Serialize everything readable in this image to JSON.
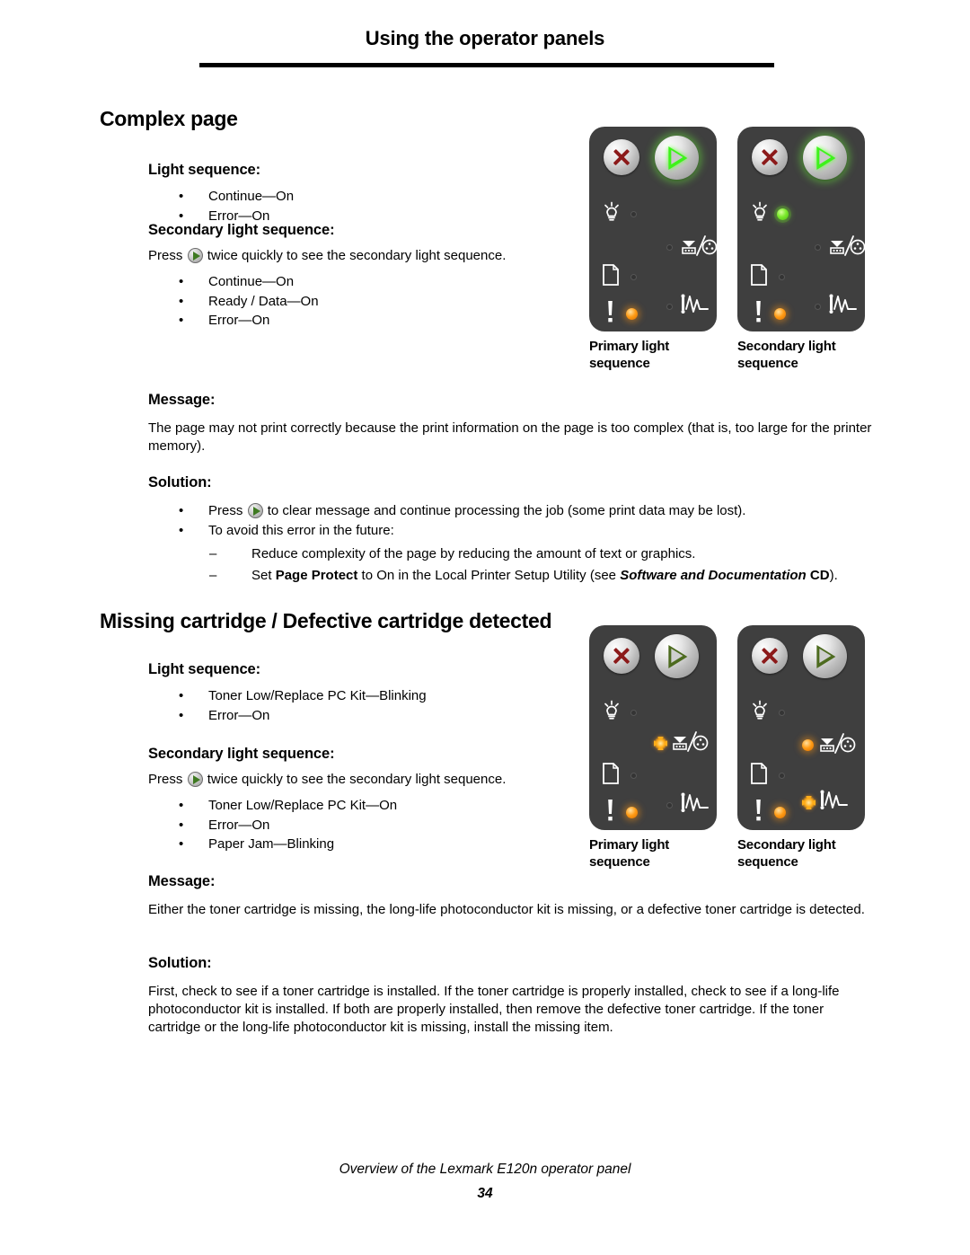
{
  "header": {
    "title": "Using the operator panels"
  },
  "footer": {
    "text": "Overview of the Lexmark E120n operator panel",
    "page_number": "34"
  },
  "labels": {
    "light_sequence": "Light sequence:",
    "secondary_light_sequence": "Secondary light sequence:",
    "message": "Message:",
    "solution": "Solution:",
    "primary_caption_line1": "Primary light",
    "primary_caption_line2": "sequence",
    "secondary_caption_line1": "Secondary light",
    "secondary_caption_line2": "sequence",
    "bullet_char": "•",
    "dash_char": "–"
  },
  "icons": {
    "cancel_button": "cancel-x-icon",
    "continue_button": "continue-triangle-icon",
    "ready_light": "lightbulb-icon",
    "load_paper_light": "paper-sheet-icon",
    "toner_light": "toner-cartridge-icon",
    "jam_light": "paper-jam-icon",
    "error_light": "exclamation-icon"
  },
  "colors": {
    "panel_background": "#3f3f3f",
    "led_green": "#7ceb2d",
    "led_amber": "#ff9b14",
    "led_off": "#343434",
    "button_metal": "#d8d8d8",
    "cancel_red": "#8c1a1a",
    "continue_green_lit": "#3ef21b",
    "continue_green_dim": "#4d6b1f"
  },
  "sections": [
    {
      "id": "complex-page",
      "title": "Complex page",
      "light_sequence": [
        "Continue—On",
        "Error—On"
      ],
      "secondary_intro_before": "Press",
      "secondary_intro_after": "twice quickly to see the secondary light sequence.",
      "secondary_light_sequence": [
        "Continue—On",
        "Ready / Data—On",
        "Error—On"
      ],
      "message": "The page may not print correctly because the print information on the page is too complex (that is, too large for the printer memory).",
      "solution_bullets": [
        {
          "before": "Press",
          "after": "to clear message and continue processing the job (some print data may be lost).",
          "has_glyph": true
        },
        {
          "before": "To avoid this error in the future:",
          "after": "",
          "has_glyph": false
        }
      ],
      "solution_dashes": [
        "Reduce complexity of the page by reducing the amount of text or graphics."
      ],
      "solution_dash_rich": {
        "p1": "Set ",
        "b1": "Page Protect",
        "p2": " to On in the Local Printer Setup Utility (see ",
        "bi1": "Software and Documentation",
        "b2": " CD",
        "p3": ")."
      },
      "panels": {
        "primary": {
          "cancel_lit": false,
          "continue_lit": true,
          "ready": "off",
          "toner": "off",
          "load_paper": "off",
          "jam": "off",
          "error": "amber-on"
        },
        "secondary": {
          "cancel_lit": false,
          "continue_lit": true,
          "ready": "green-on",
          "toner": "off",
          "load_paper": "off",
          "jam": "off",
          "error": "amber-on"
        }
      }
    },
    {
      "id": "missing-cartridge",
      "title": "Missing cartridge / Defective cartridge detected",
      "light_sequence": [
        "Toner Low/Replace PC Kit—Blinking",
        "Error—On"
      ],
      "secondary_intro_before": "Press",
      "secondary_intro_after": "twice quickly to see the secondary light sequence.",
      "secondary_light_sequence": [
        "Toner Low/Replace PC Kit—On",
        "Error—On",
        "Paper Jam—Blinking"
      ],
      "message": "Either the toner cartridge is missing, the long-life photoconductor kit is missing, or a defective toner cartridge is detected.",
      "solution": "First, check to see if a toner cartridge is installed. If the toner cartridge is properly installed, check to see if a long-life photoconductor kit is installed. If both are properly installed, then remove the defective toner cartridge. If the toner cartridge or the long-life photoconductor kit is missing, install the missing item.",
      "panels": {
        "primary": {
          "cancel_lit": false,
          "continue_lit": false,
          "ready": "off",
          "toner": "amber-blink",
          "load_paper": "off",
          "jam": "off",
          "error": "amber-on"
        },
        "secondary": {
          "cancel_lit": false,
          "continue_lit": false,
          "ready": "off",
          "toner": "amber-on",
          "load_paper": "off",
          "jam": "amber-blink",
          "error": "amber-on"
        }
      }
    }
  ]
}
